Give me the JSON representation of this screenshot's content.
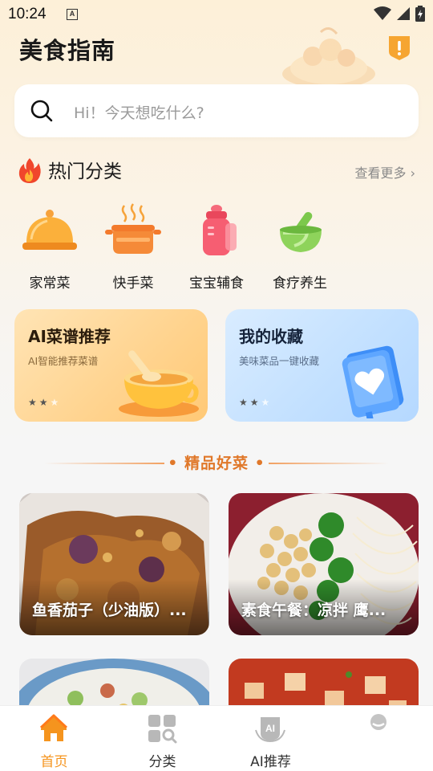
{
  "status_bar": {
    "time": "10:24",
    "notification_glyph": "A"
  },
  "header": {
    "title": "美食指南",
    "alert_icon": "alert-badge-icon"
  },
  "search": {
    "placeholder": "Hi！今天想吃什么?"
  },
  "hot": {
    "title": "热门分类",
    "more": "查看更多 ›",
    "categories": [
      {
        "label": "家常菜",
        "icon": "cloche-icon"
      },
      {
        "label": "快手菜",
        "icon": "hot-pot-icon"
      },
      {
        "label": "宝宝辅食",
        "icon": "baby-bottle-icon"
      },
      {
        "label": "食疗养生",
        "icon": "mortar-icon"
      }
    ]
  },
  "features": [
    {
      "title": "AI菜谱推荐",
      "subtitle": "AI智能推荐菜谱",
      "rating_stars": 2
    },
    {
      "title": "我的收藏",
      "subtitle": "美味菜品一键收藏",
      "rating_stars": 2
    }
  ],
  "section": {
    "title": "• 精品好菜 •"
  },
  "foods": [
    {
      "name": "鱼香茄子（少油版）..."
    },
    {
      "name": "素食午餐：凉拌 鹰..."
    },
    {
      "name": ""
    },
    {
      "name": ""
    }
  ],
  "nav": [
    {
      "label": "首页",
      "active": true
    },
    {
      "label": "分类",
      "active": false
    },
    {
      "label": "AI推荐",
      "active": false
    },
    {
      "label": "",
      "active": false
    }
  ],
  "colors": {
    "accent": "#f5941e",
    "section_title": "#e0782a"
  }
}
